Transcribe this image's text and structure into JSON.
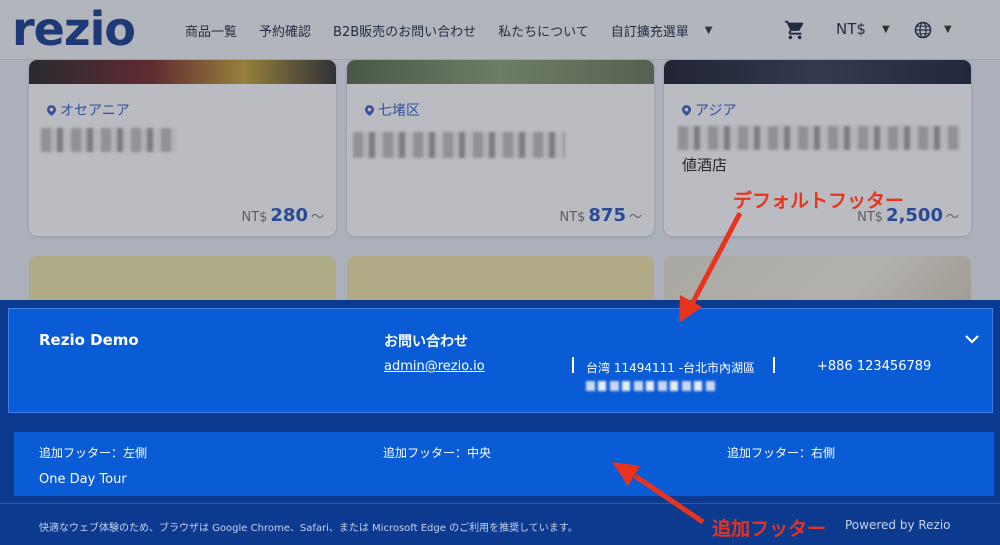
{
  "header": {
    "logo": "rezio",
    "nav": [
      "商品一覧",
      "予約確認",
      "B2B販売のお問い合わせ",
      "私たちについて",
      "自訂擴充選單"
    ],
    "currency": "NT$"
  },
  "cards": [
    {
      "location": "オセアニア",
      "currency": "NT$",
      "price": "280",
      "suffix": "〜"
    },
    {
      "location": "七堵区",
      "currency": "NT$",
      "price": "875",
      "suffix": "〜"
    },
    {
      "location": "アジア",
      "extra": "値酒店",
      "currency": "NT$",
      "price": "2,500",
      "suffix": "〜"
    }
  ],
  "default_footer": {
    "brand": "Rezio Demo",
    "contact_title": "お問い合わせ",
    "email": "admin@rezio.io",
    "address": "台湾 11494111 -台北市內湖區",
    "phone": "+886 123456789"
  },
  "extra_footer": {
    "left": "追加フッター：左側",
    "center": "追加フッター：中央",
    "right": "追加フッター：右側",
    "link": "One Day Tour"
  },
  "bottom": {
    "note": "快適なウェブ体験のため、ブラウザは Google Chrome、Safari、または Microsoft Edge のご利用を推奨しています。",
    "powered": "Powered by Rezio"
  },
  "annotations": {
    "default_footer": "デフォルトフッター",
    "extra_footer": "追加フッター"
  },
  "colors": {
    "brand_blue": "#1b3f8f",
    "footer_blue": "#0a5bd6",
    "annotation_red": "#e8331e"
  }
}
